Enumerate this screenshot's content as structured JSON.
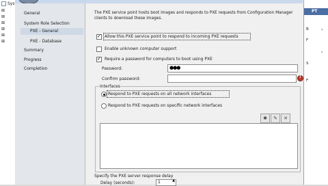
{
  "console_left": {
    "items": [
      "Sys",
      "⊞",
      "⊞",
      "⊞",
      "⊞",
      "⊞",
      "⊞"
    ]
  },
  "console_right": {
    "title": "PT",
    "rows": [
      "B",
      "F",
      "S",
      "F"
    ]
  },
  "wizard_nav": {
    "items": [
      {
        "label": "General",
        "selected": false
      },
      {
        "label": "System Role Selection",
        "selected": false
      },
      {
        "label": "PXE - General",
        "selected": true
      },
      {
        "label": "PXE - Database",
        "selected": false
      },
      {
        "label": "Summary",
        "selected": false
      },
      {
        "label": "Progress",
        "selected": false
      },
      {
        "label": "Completion",
        "selected": false
      }
    ]
  },
  "main": {
    "intro_line1": "The PXE service point hosts boot images and responds to PXE requests from Configuration Manager",
    "intro_line2": "clients to download these images.",
    "allow_pxe_label": "Allow this PXE service point to respond to incoming PXE requests",
    "allow_pxe_checked": true,
    "unknown_support_label": "Enable unknown computer support",
    "unknown_support_checked": false,
    "require_password_label": "Require a password for computers to boot using PXE",
    "require_password_checked": true,
    "password_label": "Password:",
    "password_value": "●●●",
    "confirm_password_label": "Confirm password:",
    "confirm_password_value": "",
    "interfaces_title": "Interfaces",
    "respond_all_label": "Respond to PXE requests on all network interfaces",
    "respond_all_selected": true,
    "respond_specific_label": "Respond to PXE requests on specific network interfaces",
    "respond_specific_selected": false,
    "delay_heading": "Specify the PXE server response delay",
    "delay_label": "Delay (seconds):",
    "delay_value": "1"
  },
  "toolbar_icons": [
    "star-icon",
    "edit-icon",
    "delete-icon"
  ],
  "colors": {
    "nav_bg": "#e3e6ea",
    "nav_selected": "#cfd9e6",
    "dialog_bg": "#f0f0f0",
    "error_icon": "#c0392b",
    "console_title_bar": "#4b6ea3"
  }
}
